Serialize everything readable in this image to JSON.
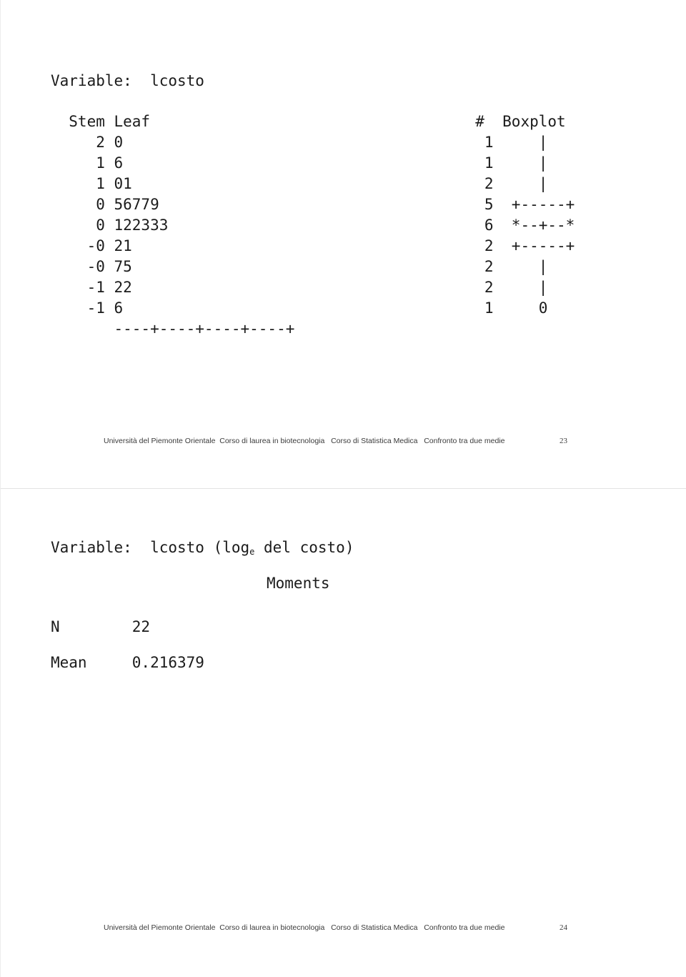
{
  "document": {
    "background_color": "#ffffff",
    "text_color": "#1b1b1b",
    "divider_color": "#e3e3e3"
  },
  "slide_1": {
    "title": "Variable:  lcosto",
    "stemleaf": {
      "header": "  Stem Leaf                                    #  Boxplot",
      "rows": [
        "     2 0                                        1     |",
        "     1 6                                        1     |",
        "     1 01                                       2     |",
        "     0 56779                                    5  +-----+",
        "     0 122333                                   6  *--+--*",
        "    -0 21                                       2  +-----+",
        "    -0 75                                       2     |",
        "    -1 22                                       2     |",
        "    -1 6                                        1     0"
      ],
      "axis": "       ----+----+----+----+",
      "full_text": "  Stem Leaf                                    #  Boxplot\n     2 0                                        1     |\n     1 6                                        1     |\n     1 01                                       2     |\n     0 56779                                    5  +-----+\n     0 122333                                   6  *--+--*\n    -0 21                                       2  +-----+\n    -0 75                                       2     |\n    -1 22                                       2     |\n    -1 6                                        1     0\n       ----+----+----+----+"
    },
    "footer": {
      "text": "Università del Piemonte Orientale  Corso di laurea in biotecnologia   Corso di Statistica Medica   Confronto tra due medie",
      "page": "23"
    }
  },
  "slide_2": {
    "title_prefix": "Variable:  lcosto (log",
    "title_sub": "e",
    "title_suffix": " del costo)",
    "moments_heading": "Moments",
    "stats_text": "N        22\nMean     0.216379",
    "stats": [
      {
        "label": "N",
        "value": "22"
      },
      {
        "label": "Mean",
        "value": "0.216379"
      }
    ],
    "footer": {
      "text": "Università del Piemonte Orientale  Corso di laurea in biotecnologia   Corso di Statistica Medica   Confronto tra due medie",
      "page": "24"
    }
  }
}
